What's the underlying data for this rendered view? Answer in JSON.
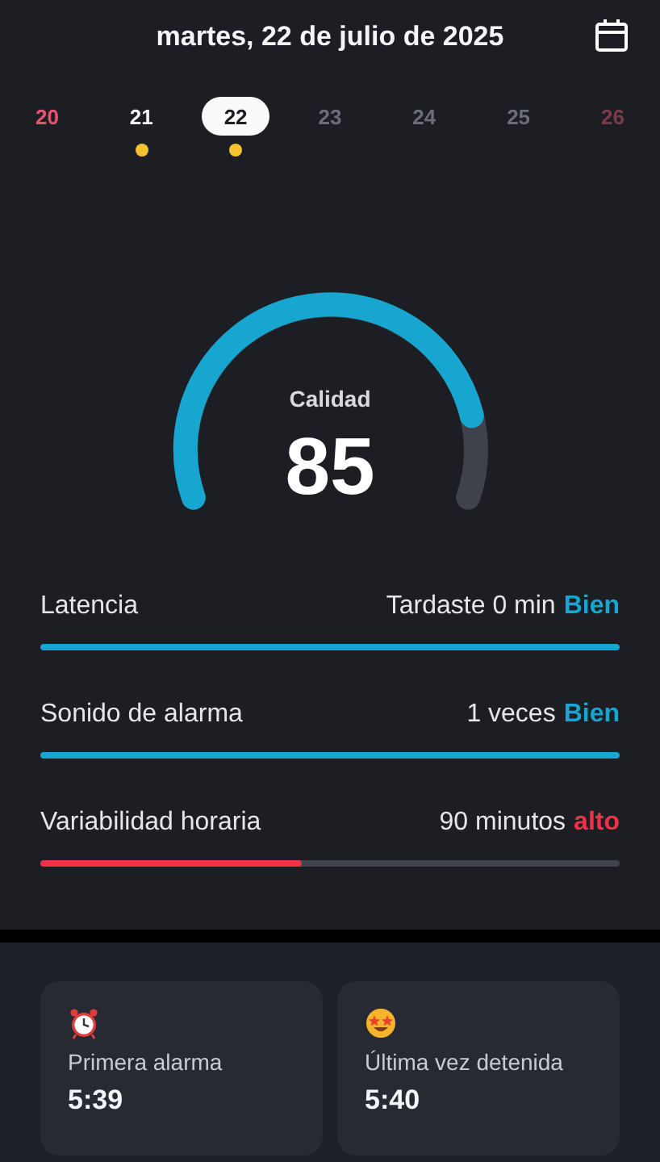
{
  "header": {
    "title": "martes, 22 de julio de 2025"
  },
  "days": [
    {
      "label": "20",
      "color": "#e5566e",
      "selected": false,
      "recorded": false
    },
    {
      "label": "21",
      "color": "#f2f3f5",
      "selected": false,
      "recorded": true
    },
    {
      "label": "22",
      "color": "#1c1e24",
      "selected": true,
      "recorded": true
    },
    {
      "label": "23",
      "color": "#6b6e78",
      "selected": false,
      "recorded": false
    },
    {
      "label": "24",
      "color": "#6b6e78",
      "selected": false,
      "recorded": false
    },
    {
      "label": "25",
      "color": "#6b6e78",
      "selected": false,
      "recorded": false
    },
    {
      "label": "26",
      "color": "#7a3b48",
      "selected": false,
      "recorded": false
    }
  ],
  "gauge": {
    "label": "Calidad",
    "value": "85"
  },
  "metrics": [
    {
      "label": "Latencia",
      "reading": "Tardaste 0 min",
      "rating": "Bien",
      "kind": "good",
      "level": 1
    },
    {
      "label": "Sonido de alarma",
      "reading": "1 veces",
      "rating": "Bien",
      "kind": "good",
      "level": 1
    },
    {
      "label": "Variabilidad horaria",
      "reading": "90 minutos",
      "rating": "alto",
      "kind": "bad",
      "level": 0.45
    }
  ],
  "cards": [
    {
      "kind": "alarm",
      "label": "Primera alarma",
      "time": "5:39"
    },
    {
      "kind": "starry",
      "label": "Última vez detenida",
      "time": "5:40"
    }
  ]
}
